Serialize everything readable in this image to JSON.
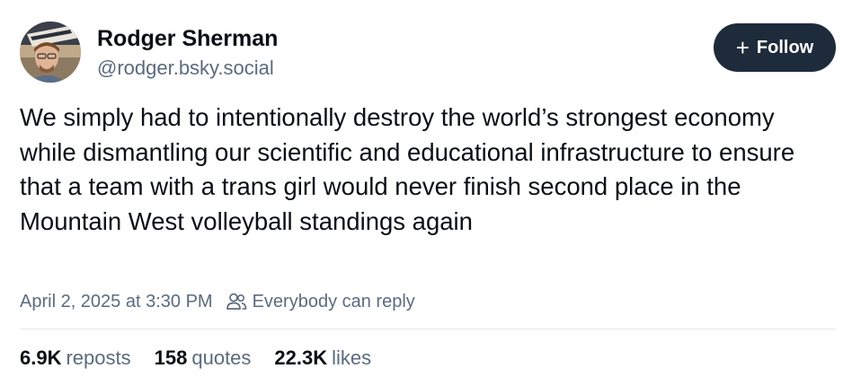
{
  "author": {
    "name": "Rodger Sherman",
    "handle": "@rodger.bsky.social"
  },
  "follow_button": {
    "icon": "plus-icon",
    "label": "Follow"
  },
  "post": {
    "text": "We simply had to intentionally destroy the world’s strongest economy while dismantling our scientific and educational infrastructure to ensure that a team with a trans girl would never finish second place in the Mountain West volleyball standings again",
    "timestamp": "April 2, 2025 at 3:30 PM",
    "reply_setting": "Everybody can reply",
    "reply_icon": "people-icon"
  },
  "stats": {
    "reposts": {
      "count": "6.9K",
      "label": "reposts"
    },
    "quotes": {
      "count": "158",
      "label": "quotes"
    },
    "likes": {
      "count": "22.3K",
      "label": "likes"
    }
  },
  "colors": {
    "button_bg": "#1e2b3a",
    "muted_text": "#5b6b7e",
    "divider": "#e2e7ed"
  }
}
